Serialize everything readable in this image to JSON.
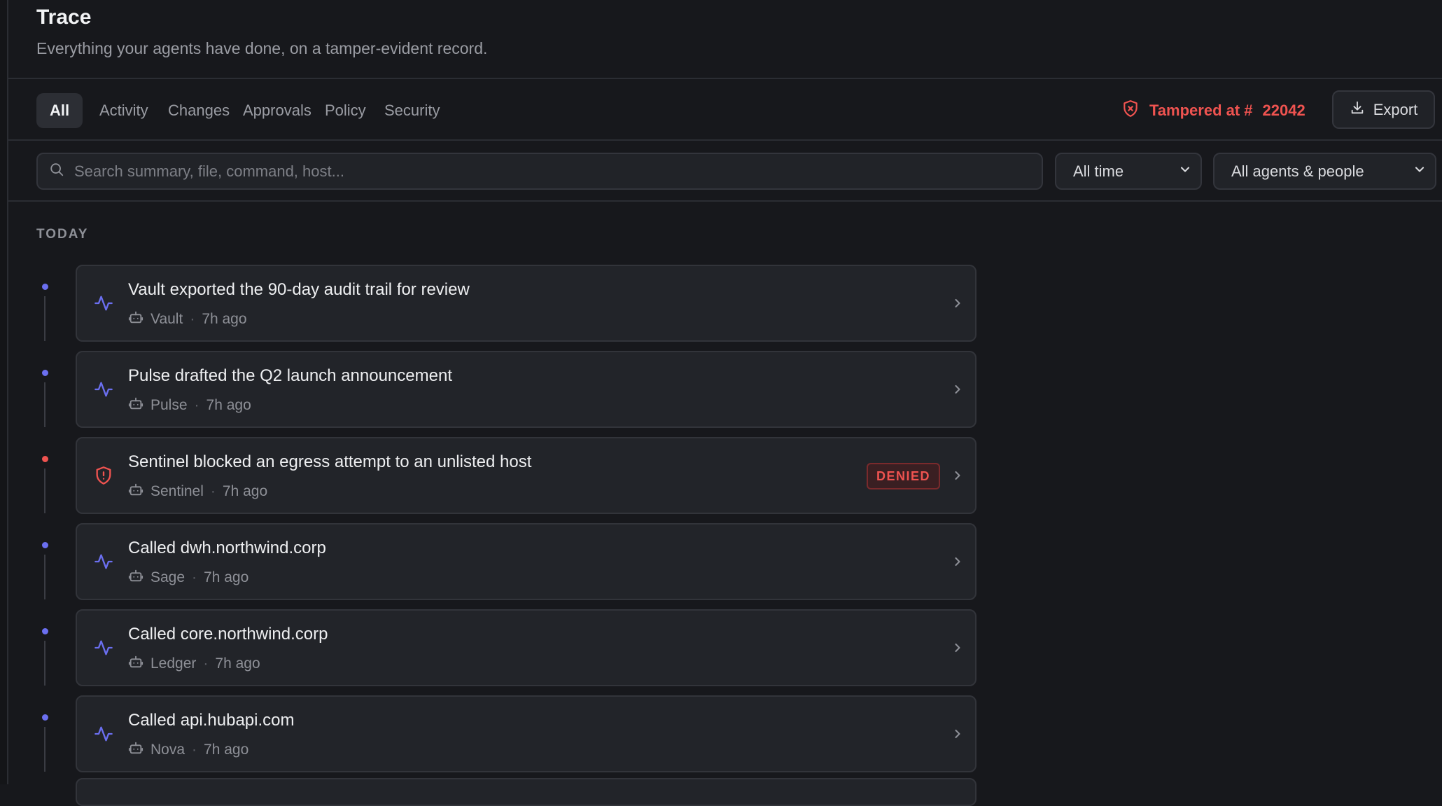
{
  "header": {
    "title": "Trace",
    "subtitle": "Everything your agents have done, on a tamper-evident record."
  },
  "tabs": [
    {
      "label": "All",
      "active": true
    },
    {
      "label": "Activity",
      "active": false
    },
    {
      "label": "Changes",
      "active": false
    },
    {
      "label": "Approvals",
      "active": false
    },
    {
      "label": "Policy",
      "active": false
    },
    {
      "label": "Security",
      "active": false
    }
  ],
  "integrity": {
    "label": "Tampered at #",
    "sequence": "22042",
    "icon": "shield-x-icon",
    "color": "#ef5350"
  },
  "toolbar": {
    "export_label": "Export",
    "export_icon": "download-icon"
  },
  "filters": {
    "search_placeholder": "Search summary, file, command, host...",
    "search_value": "",
    "time_value": "All time",
    "actor_value": "All agents & people"
  },
  "sections": [
    {
      "label": "TODAY",
      "events": [
        {
          "title": "Vault exported the 90-day audit trail for review",
          "actor": "Vault",
          "time": "7h ago",
          "kind": "activity",
          "icon": "activity-icon",
          "badge": ""
        },
        {
          "title": "Pulse drafted the Q2 launch announcement",
          "actor": "Pulse",
          "time": "7h ago",
          "kind": "activity",
          "icon": "activity-icon",
          "badge": ""
        },
        {
          "title": "Sentinel blocked an egress attempt to an unlisted host",
          "actor": "Sentinel",
          "time": "7h ago",
          "kind": "security",
          "icon": "shield-alert-icon",
          "badge": "DENIED"
        },
        {
          "title": "Called dwh.northwind.corp",
          "actor": "Sage",
          "time": "7h ago",
          "kind": "activity",
          "icon": "activity-icon",
          "badge": ""
        },
        {
          "title": "Called core.northwind.corp",
          "actor": "Ledger",
          "time": "7h ago",
          "kind": "activity",
          "icon": "activity-icon",
          "badge": ""
        },
        {
          "title": "Called api.hubapi.com",
          "actor": "Nova",
          "time": "7h ago",
          "kind": "activity",
          "icon": "activity-icon",
          "badge": ""
        }
      ]
    }
  ],
  "colors": {
    "background": "#17181c",
    "card": "#222429",
    "accent": "#6b6ff0",
    "danger": "#ef5350",
    "muted": "#8e9097"
  }
}
